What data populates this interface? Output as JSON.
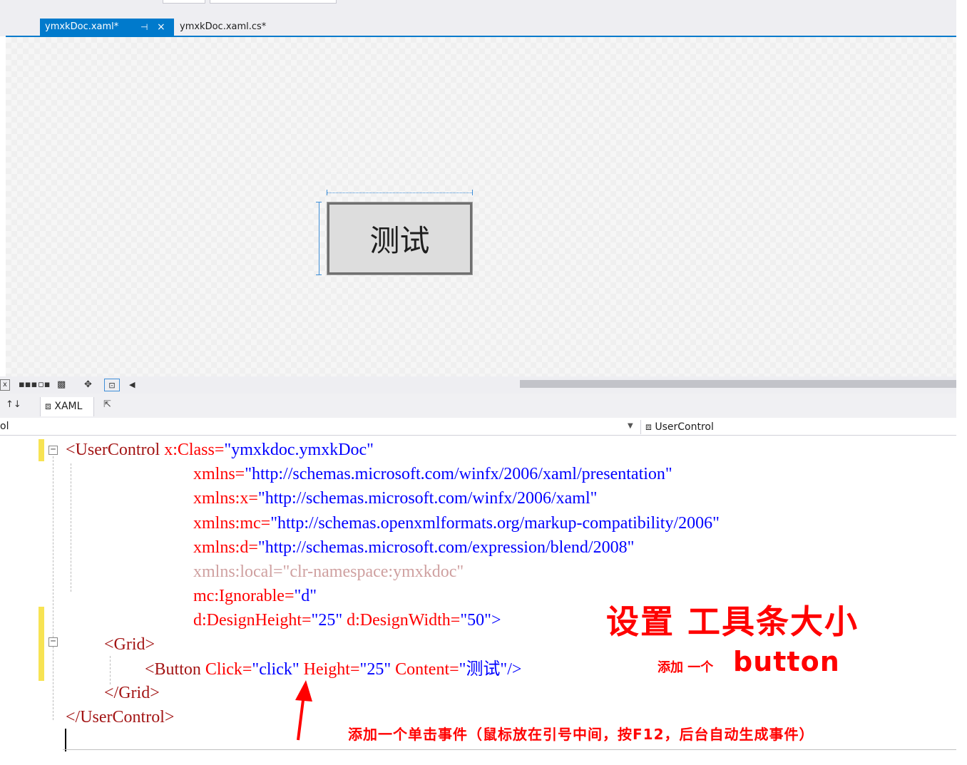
{
  "tabs": {
    "active": {
      "label": "ymxkDoc.xaml*",
      "pin": "⊣",
      "close": "×"
    },
    "inactive": {
      "label": "ymxkDoc.xaml.cs*"
    }
  },
  "designer": {
    "button_label": "测试"
  },
  "split": {
    "swap_icon": "↑↓",
    "xaml_tab_label": "XAML",
    "xaml_tab_icon": "⧈",
    "popout_icon": "⇱"
  },
  "navbar": {
    "left_text": "ol",
    "right_icon": "⧈",
    "right_text": "UserControl"
  },
  "code": {
    "line1_tag": "<UserControl",
    "line1_attr": " x:Class=",
    "line1_val": "\"ymxkdoc.ymxkDoc\"",
    "line2_attr": "xmlns=",
    "line2_val": "\"http://schemas.microsoft.com/winfx/2006/xaml/presentation\"",
    "line3_attr": "xmlns:x=",
    "line3_val": "\"http://schemas.microsoft.com/winfx/2006/xaml\"",
    "line4_attr": "xmlns:mc=",
    "line4_val": "\"http://schemas.openxmlformats.org/markup-compatibility/2006\"",
    "line5_attr": "xmlns:d=",
    "line5_val": "\"http://schemas.microsoft.com/expression/blend/2008\"",
    "line6_text": "xmlns:local=\"clr-namespace:ymxkdoc\"",
    "line7_attr": "mc:Ignorable=",
    "line7_val": "\"d\"",
    "line8_attr1": "d:DesignHeight=",
    "line8_val1": "\"25\"",
    "line8_attr2": " d:DesignWidth=",
    "line8_val2": "\"50\"",
    "line8_close": ">",
    "line9_tag": "<Grid>",
    "line10_tag": "<Button",
    "line10_attr1": " Click=",
    "line10_val1": "\"click\"",
    "line10_attr2": " Height=",
    "line10_val2": "\"25\"",
    "line10_attr3": " Content=",
    "line10_val3": "\"测试\"",
    "line10_close": "/>",
    "line11_tag": "</Grid>",
    "line12_tag": "</UserControl>"
  },
  "annotations": {
    "size_note": "设置 工具条大小",
    "button_note_prefix": "添加 一个",
    "button_note_word": "button",
    "event_note": "添加一个单击事件（鼠标放在引号中间，按F12，后台自动生成事件）"
  },
  "colors": {
    "accent": "#007acc",
    "annotation": "#ff0000",
    "changed_marker": "#f7e353"
  }
}
